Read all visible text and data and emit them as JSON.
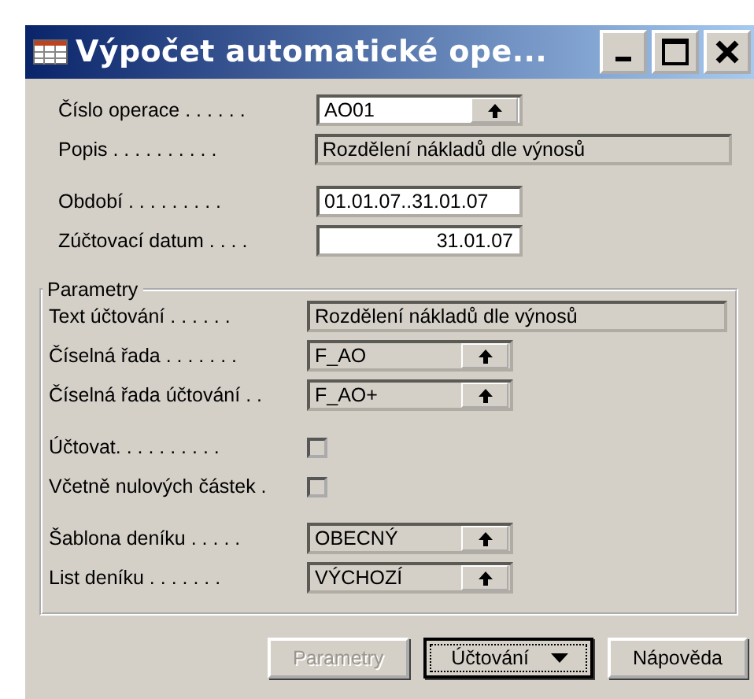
{
  "window": {
    "title": "Výpočet automatické ope..."
  },
  "field_blocks": [
    [
      {
        "label": "Číslo operace . . . . . .",
        "kind": "lookup",
        "value": "AO01",
        "editable": true
      },
      {
        "label": "Popis . . . . . . . . . .",
        "kind": "text",
        "value": "Rozdělení nákladů dle výnosů",
        "editable": false
      }
    ],
    [
      {
        "label": "Období . . . . . . . . .",
        "kind": "text",
        "value": "01.01.07..31.01.07",
        "editable": true
      },
      {
        "label": "Zúčtovací datum . . . .",
        "kind": "date",
        "value": "31.01.07",
        "editable": true
      }
    ]
  ],
  "group": {
    "title": "Parametry",
    "field_blocks": [
      [
        {
          "label": "Text účtování . . . . . .",
          "kind": "text",
          "value": "Rozdělení nákladů dle výnosů",
          "editable": false
        },
        {
          "label": "Číselná řada . . . . . . .",
          "kind": "lookup",
          "value": "F_AO",
          "editable": false
        },
        {
          "label": "Číselná řada účtování . .",
          "kind": "lookup",
          "value": "F_AO+",
          "editable": false
        }
      ],
      [
        {
          "label": "Účtovat. . . . . . . . . .",
          "kind": "checkbox",
          "checked": false
        },
        {
          "label": "Včetně nulových částek .",
          "kind": "checkbox",
          "checked": false
        }
      ],
      [
        {
          "label": "Šablona deníku . . . . .",
          "kind": "lookup",
          "value": "OBECNÝ",
          "editable": false
        },
        {
          "label": "List deníku . . . . . . .",
          "kind": "lookup",
          "value": "VÝCHOZÍ",
          "editable": false
        }
      ]
    ]
  },
  "buttons": [
    {
      "label": "Parametry",
      "disabled": true,
      "focused": false,
      "menu": false
    },
    {
      "label": "Účtování",
      "disabled": false,
      "focused": true,
      "menu": true
    },
    {
      "label": "Nápověda",
      "disabled": false,
      "focused": false,
      "menu": false
    }
  ]
}
